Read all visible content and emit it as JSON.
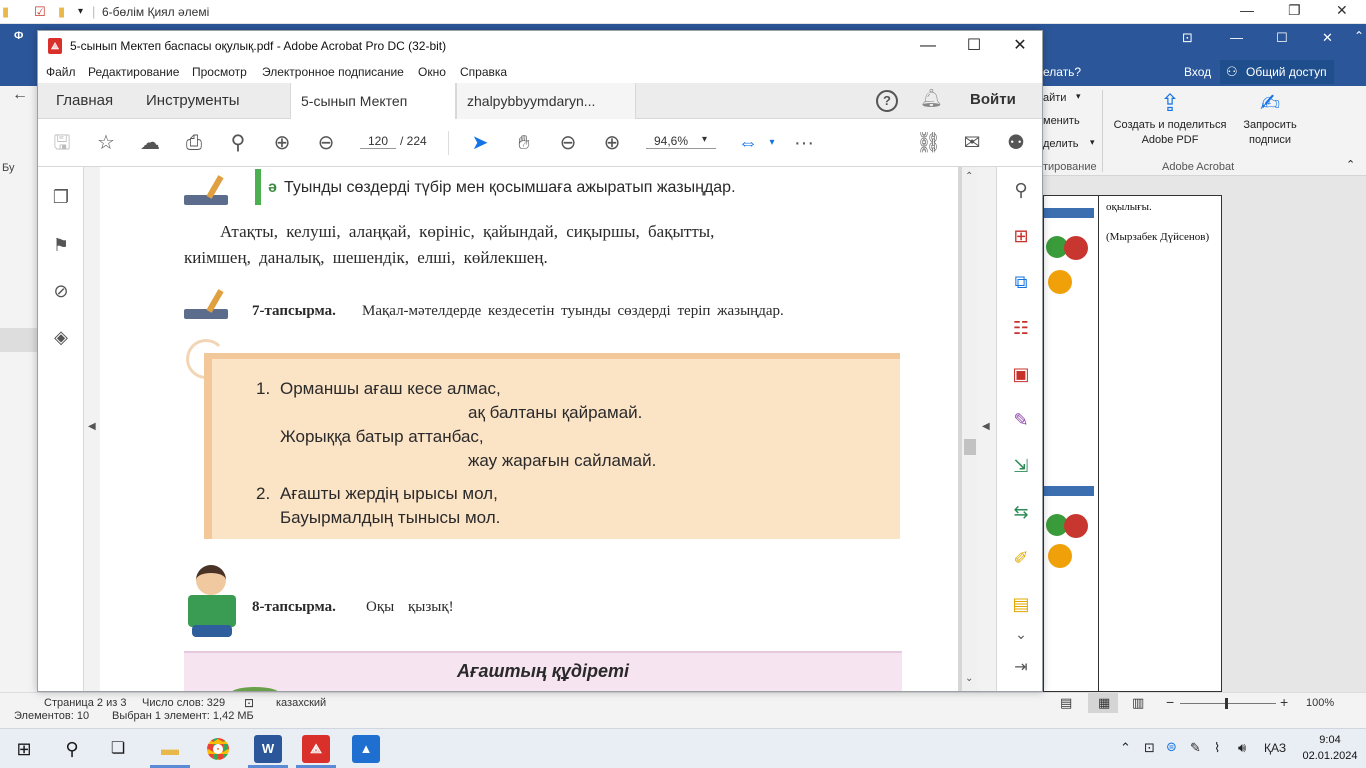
{
  "explorer": {
    "title": "6-бөлім Қиял әлемі",
    "status_items": "Элементов: 10",
    "status_selected": "Выбран 1 элемент: 1,42 МБ"
  },
  "word": {
    "ribbon_question": "елать?",
    "signin": "Вход",
    "share": "Общий доступ",
    "ribbon_frag_1": "айти",
    "ribbon_frag_2": "менить",
    "ribbon_frag_3": "делить",
    "ribbon_frag_4": "тирование",
    "create_share_pdf": "Создать и поделиться Adobe PDF",
    "request_signatures": "Запросить подписи",
    "group_adobe": "Adobe Acrobat",
    "cell_text_1": "оқылығы.",
    "cell_text_2": "(Мырзабек Дүйсенов)",
    "status_page": "Страница 2 из 3",
    "status_words": "Число слов: 329",
    "status_lang": "казахский",
    "zoom": "100%",
    "left_tab_1": "Ф",
    "left_tab_2": "Бу"
  },
  "acrobat": {
    "title": "5-сынып Мектеп баспасы оқулық.pdf - Adobe Acrobat Pro DC (32-bit)",
    "menu": [
      "Файл",
      "Редактирование",
      "Просмотр",
      "Электронное подписание",
      "Окно",
      "Справка"
    ],
    "tabs": {
      "home": "Главная",
      "tools": "Инструменты",
      "doc1": "5-сынып Мектеп б...",
      "doc2": "zhalpybbyymdaryn..."
    },
    "signin": "Войти",
    "page_current": "120",
    "page_total": "/  224",
    "zoom": "94,6%"
  },
  "pdf": {
    "task6_heading": "Туынды сөздерді түбір мен қосымшаға ажыратып жазыңдар.",
    "task6_marker": "ә",
    "task6_words_line1": "Атақты,   келуші,   алаңқай,   көрініс,   қайындай,   сиқыршы,   бақытты,",
    "task6_words_line2": "киімшең,   даналық,   шешендік,   елші,   көйлекшең.",
    "task7_label": "7-тапсырма.",
    "task7_text": "Мақал-мәтелдерде  кездесетін  туынды  сөздерді  теріп  жазыңдар.",
    "prov1_num": "1.",
    "prov1_l1": "Орманшы ағаш кесе алмас,",
    "prov1_l2": "ақ балтаны қайрамай.",
    "prov1_l3": "Жорыққа батыр аттанбас,",
    "prov1_l4": "жау жарағын сайламай.",
    "prov2_num": "2.",
    "prov2_l1": "Ағашты жердің ырысы мол,",
    "prov2_l2": "Бауырмалдың тынысы мол.",
    "task8_label": "8-тапсырма.",
    "task8_text": "Оқы қызық!",
    "story_title": "Ағаштың  құдіреті"
  },
  "taskbar": {
    "lang": "ҚАЗ",
    "time": "9:04",
    "date": "02.01.2024"
  },
  "colors": {
    "word_blue": "#2b579a",
    "acrobat_red": "#d9302c",
    "box_peach": "#fbe3c6",
    "box_pink": "#f6e4f1",
    "icon_red": "#c8302a",
    "icon_blue": "#1473e6"
  }
}
